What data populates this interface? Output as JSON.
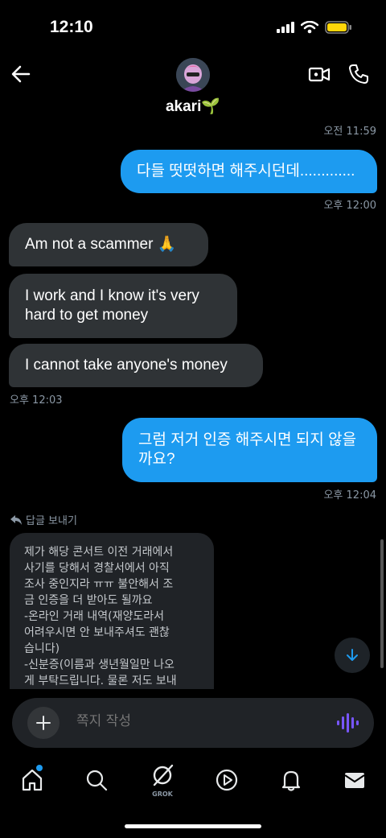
{
  "status_bar": {
    "time": "12:10"
  },
  "header": {
    "contact_name": "akari🌱"
  },
  "messages": [
    {
      "type": "timestamp",
      "text": "오전 11:59"
    },
    {
      "type": "out",
      "text": "다들 떳떳하면 해주시던데............."
    },
    {
      "type": "timestamp",
      "text": "오후 12:00"
    },
    {
      "type": "in",
      "text": "Am not a scammer 🙏"
    },
    {
      "type": "in",
      "text": "I work and I know it's very hard to get money"
    },
    {
      "type": "in",
      "text": "I cannot take anyone's money"
    },
    {
      "type": "timestamp",
      "text": "오후 12:03"
    },
    {
      "type": "out",
      "text": "그럼 저거 인증 해주시면 되지 않을까요?"
    },
    {
      "type": "timestamp",
      "text": "오후 12:04"
    }
  ],
  "reply": {
    "label": "답글 보내기",
    "quoted_text": "제가 해당 콘서트 이전 거래에서\n사기를 당해서 경찰서에서 아직\n조사 중인지라 ㅠㅠ 불안해서 조\n금 인증을 더 받아도 될까요\n-온라인 거래 내역(재양도라서\n어려우시면 안 보내주셔도 괜찮\n습니다)\n-신분증(이름과 생년월일만 나오\n게 부탁드립니다. 물론 저도 보내"
  },
  "composer": {
    "placeholder": "쪽지 작성"
  },
  "tabbar": {
    "grok_label": "GROK"
  },
  "colors": {
    "accent": "#1d9bf0",
    "incoming_bubble": "#2f3336",
    "voice": "#7856ff"
  }
}
